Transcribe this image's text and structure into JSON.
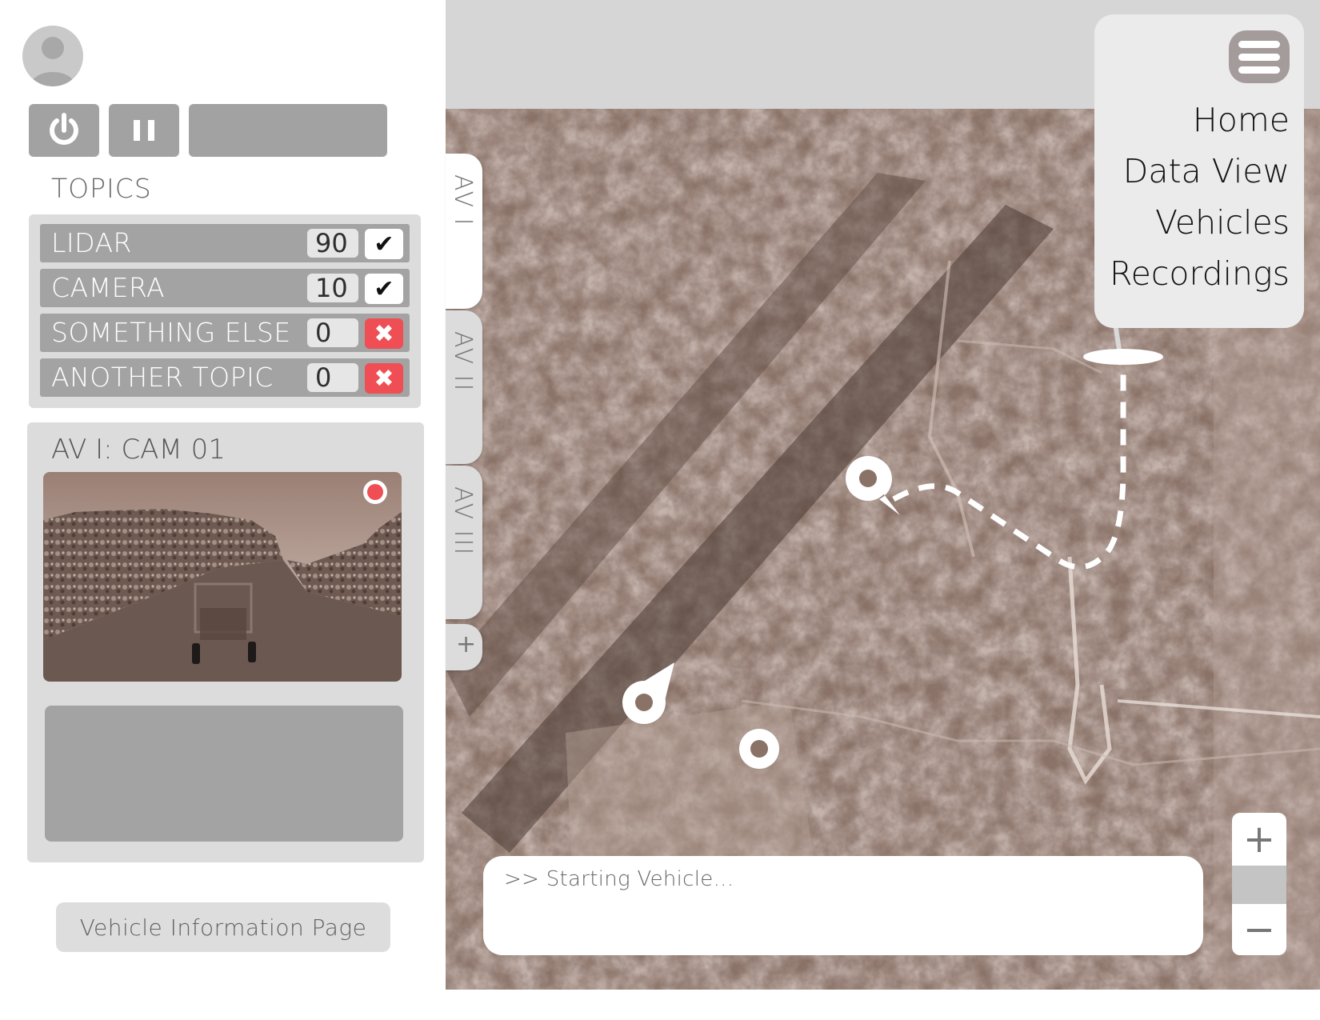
{
  "sidebar": {
    "topics_label": "TOPICS",
    "topics": [
      {
        "name": "LIDAR",
        "count": "90",
        "enabled": true,
        "mark": "✔"
      },
      {
        "name": "CAMERA",
        "count": "10",
        "enabled": true,
        "mark": "✔"
      },
      {
        "name": "SOMETHING ELSE",
        "count": "0",
        "enabled": false,
        "mark": "✖"
      },
      {
        "name": "ANOTHER TOPIC",
        "count": "0",
        "enabled": false,
        "mark": "✖"
      }
    ],
    "camera": {
      "title": "AV I: CAM 01"
    },
    "vehicle_info_button": "Vehicle Information Page"
  },
  "tabs": [
    "AV I",
    "AV II",
    "AV III"
  ],
  "add_tab_label": "+",
  "nav": {
    "items": [
      "Home",
      "Data View",
      "Vehicles",
      "Recordings"
    ]
  },
  "console": {
    "text": ">> Starting Vehicle..."
  },
  "zoom": {
    "in_label": "+",
    "out_label": "−"
  },
  "colors": {
    "accent_red": "#ef4f54",
    "panel_gray": "#dcdcdc",
    "button_gray": "#a3a3a3",
    "map_sepia": "#8c7468"
  }
}
